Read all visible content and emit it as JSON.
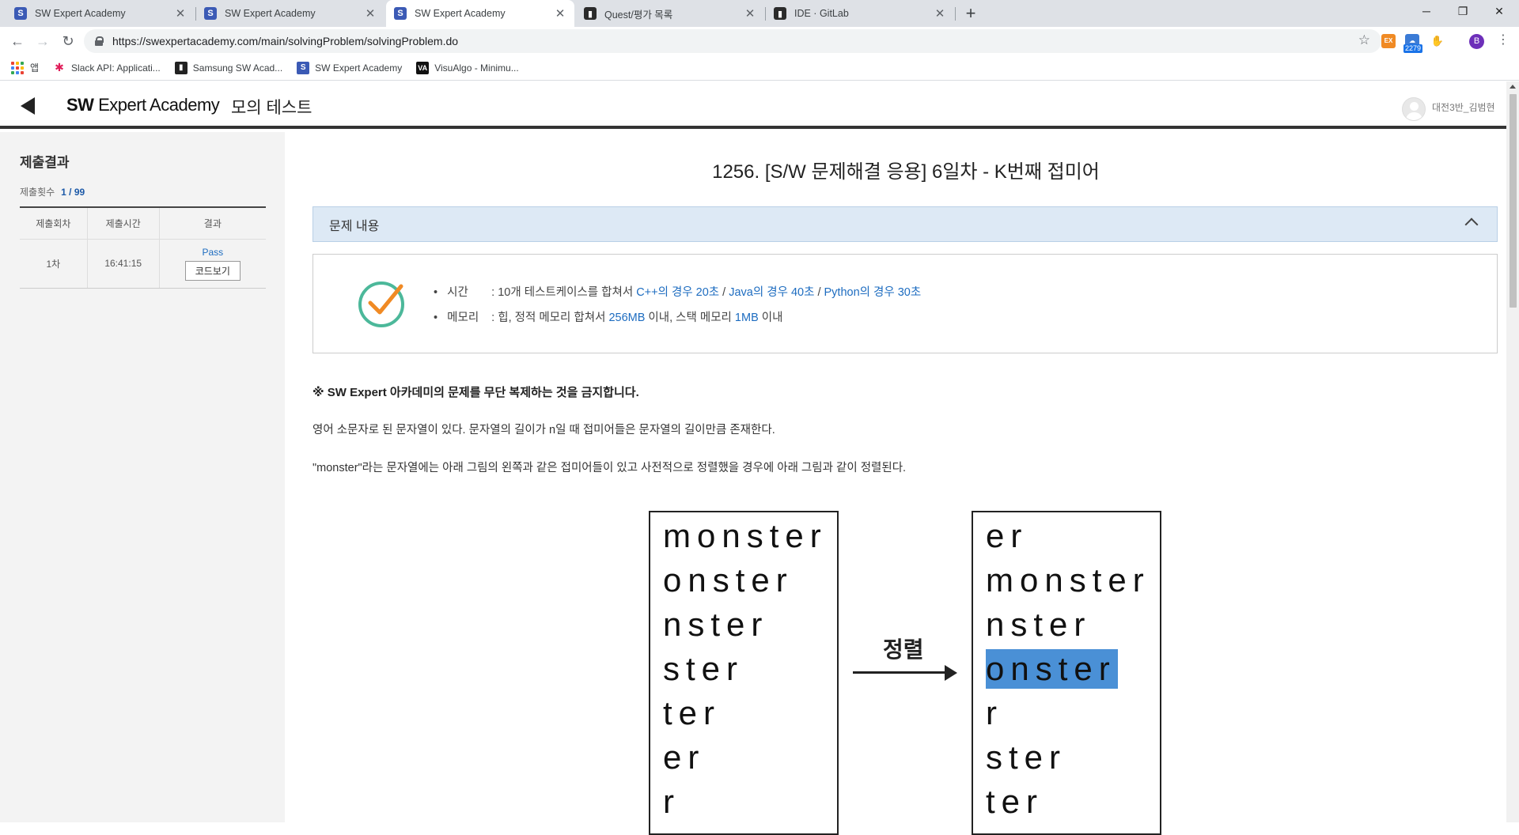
{
  "browser": {
    "tabs": [
      {
        "title": "SW Expert Academy",
        "favicon": "S",
        "active": false
      },
      {
        "title": "SW Expert Academy",
        "favicon": "S",
        "active": false
      },
      {
        "title": "SW Expert Academy",
        "favicon": "S",
        "active": true
      },
      {
        "title": "Quest/평가 목록",
        "favicon": "G",
        "active": false
      },
      {
        "title": "IDE · GitLab",
        "favicon": "G",
        "active": false
      }
    ],
    "url": "https://swexpertacademy.com/main/solvingProblem/solvingProblem.do",
    "extension_badge": "2279",
    "profile_initial": "B",
    "bookmarks": {
      "apps": "앱",
      "items": [
        "Slack API: Applicati...",
        "Samsung SW Acad...",
        "SW Expert Academy",
        "VisuAlgo - Minimu..."
      ]
    }
  },
  "header": {
    "brand_bold": "SW",
    "brand_rest": "Expert Academy",
    "subtitle": "모의 테스트",
    "user_name": "대전3반_김범현"
  },
  "submission": {
    "title": "제출결과",
    "count_label": "제출횟수",
    "count_value": "1 / 99",
    "columns": [
      "제출회차",
      "제출시간",
      "결과"
    ],
    "rows": [
      {
        "round": "1차",
        "time": "16:41:15",
        "result": "Pass",
        "code_button": "코드보기"
      }
    ]
  },
  "problem": {
    "title": "1256. [S/W 문제해결 응용] 6일차 - K번째 접미어",
    "section_label": "문제 내용",
    "time_label": "시간",
    "time_prefix": ": 10개 테스트케이스를 합쳐서 ",
    "time_cpp": "C++의 경우 20초",
    "time_sep1": " / ",
    "time_java": "Java의 경우 40초",
    "time_sep2": " / ",
    "time_python": "Python의 경우 30초",
    "memory_label": "메모리",
    "memory_prefix": ": 힙, 정적 메모리 합쳐서 ",
    "memory_heap": "256MB",
    "memory_mid": " 이내, 스택 메모리 ",
    "memory_stack": "1MB",
    "memory_suffix": " 이내",
    "warning": "※ SW Expert 아카데미의 문제를 무단 복제하는 것을 금지합니다.",
    "para1": "영어 소문자로 된 문자열이 있다. 문자열의 길이가 n일 때 접미어들은 문자열의 길이만큼 존재한다.",
    "para2": "\"monster\"라는 문자열에는 아래 그림의 왼쪽과 같은 접미어들이 있고 사전적으로 정렬했을 경우에 아래 그림과 같이 정렬된다."
  },
  "figure": {
    "left_words": [
      "monster",
      "onster",
      "nster",
      "ster",
      "ter",
      "er",
      "r"
    ],
    "right_words": [
      "er",
      "monster",
      "nster",
      "onster",
      "r",
      "ster",
      "ter"
    ],
    "highlighted_right_index": 3,
    "arrow_label": "정렬",
    "highlight_color": "#4a90d6"
  }
}
